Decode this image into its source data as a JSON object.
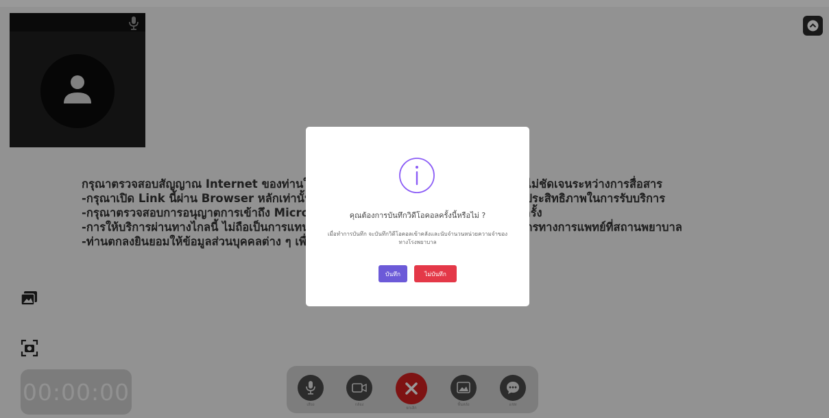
{
  "notice": {
    "lines": [
      "กรุณาตรวจสอบสัญญาณ Internet ของท่านให้มีความเสถียร เพื่อไม่ให้เกิดความติดขัดหรือไม่ชัดเจนระหว่างการสื่อสาร",
      "-กรุณาเปิด Link นี้ผ่าน Browser หลักเท่านั้น เช่น Google Chrome หรือ Safari เพื่อประสิทธิภาพในการรับบริการ",
      "-กรุณาตรวจสอบการอนุญาตการเข้าถึง Microphone และ Camera ของอุปกรณ์ท่านทุกครั้ง",
      "-การให้บริการผ่านทางไกลนี้ ไม่ถือเป็นการแทนที่การตรวจรักษาโดยตรงจากแพทย์หรือบุคลากรทางการแพทย์ที่สถานพยาบาล",
      "-ท่านตกลงยินยอมให้ข้อมูลส่วนบุคคลต่าง ๆ เพื่อใช้ในการรับบริการ"
    ]
  },
  "timer": "00:00:00",
  "toolbar": {
    "mic_label": "เสียง",
    "camera_label": "กล้อง",
    "end_label": "ยกเลิก",
    "background_label": "พื้นหลัง",
    "chat_label": "แชท"
  },
  "modal": {
    "title": "คุณต้องการบันทึกวิดีโอคอลครั้งนี้หรือไม่ ?",
    "description": "เมื่อทำการบันทึก จะบันทึกวิดีโอคอลเข้าคลังและนับจำนวนหน่วยความจำของทางโรงพยาบาล",
    "save_label": "บันทึก",
    "nosave_label": "ไม่บันทึก"
  },
  "colors": {
    "accent_purple": "#6c5ad8",
    "danger_red": "#e43848",
    "end_call_red": "#d32020"
  },
  "icons": [
    "microphone-icon",
    "expand-icon",
    "avatar-icon",
    "image-icon",
    "screenshot-icon",
    "video-camera-icon",
    "close-icon",
    "chat-icon",
    "info-icon"
  ]
}
